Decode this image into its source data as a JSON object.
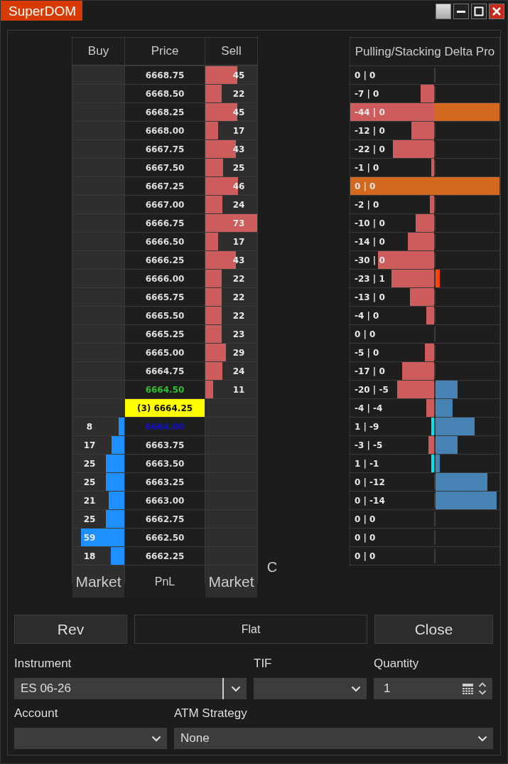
{
  "window": {
    "title": "SuperDOM"
  },
  "ladder": {
    "columns": [
      "Buy",
      "Price",
      "Sell"
    ],
    "rows": [
      {
        "price": "6668.75",
        "kind": "ask",
        "sell": {
          "volume": "45",
          "level": 0.62
        }
      },
      {
        "price": "6668.50",
        "kind": "ask",
        "sell": {
          "volume": "22",
          "level": 0.31
        }
      },
      {
        "price": "6668.25",
        "kind": "ask",
        "sell": {
          "volume": "45",
          "level": 0.62
        }
      },
      {
        "price": "6668.00",
        "kind": "ask",
        "sell": {
          "volume": "17",
          "level": 0.24
        }
      },
      {
        "price": "6667.75",
        "kind": "ask",
        "sell": {
          "volume": "43",
          "level": 0.59
        }
      },
      {
        "price": "6667.50",
        "kind": "ask",
        "sell": {
          "volume": "25",
          "level": 0.34
        }
      },
      {
        "price": "6667.25",
        "kind": "ask",
        "sell": {
          "volume": "46",
          "level": 0.63
        }
      },
      {
        "price": "6667.00",
        "kind": "ask",
        "sell": {
          "volume": "24",
          "level": 0.33
        }
      },
      {
        "price": "6666.75",
        "kind": "ask",
        "sell": {
          "volume": "73",
          "level": 1
        }
      },
      {
        "price": "6666.50",
        "kind": "ask",
        "sell": {
          "volume": "17",
          "level": 0.24
        }
      },
      {
        "price": "6666.25",
        "kind": "ask",
        "sell": {
          "volume": "43",
          "level": 0.59
        }
      },
      {
        "price": "6666.00",
        "kind": "ask",
        "sell": {
          "volume": "22",
          "level": 0.31
        }
      },
      {
        "price": "6665.75",
        "kind": "ask",
        "sell": {
          "volume": "22",
          "level": 0.31
        }
      },
      {
        "price": "6665.50",
        "kind": "ask",
        "sell": {
          "volume": "22",
          "level": 0.31
        }
      },
      {
        "price": "6665.25",
        "kind": "ask",
        "sell": {
          "volume": "23",
          "level": 0.32
        }
      },
      {
        "price": "6665.00",
        "kind": "ask",
        "sell": {
          "volume": "29",
          "level": 0.4
        }
      },
      {
        "price": "6664.75",
        "kind": "ask",
        "sell": {
          "volume": "24",
          "level": 0.33
        }
      },
      {
        "price": "6664.50",
        "kind": "last",
        "sell": {
          "volume": "11",
          "level": 0.15
        }
      },
      {
        "price": "(3) 6664.25",
        "kind": "position"
      },
      {
        "price": "6664.00",
        "kind": "bestbid",
        "buy": {
          "volume": "8",
          "level": 0.11
        }
      },
      {
        "price": "6663.75",
        "kind": "bid",
        "buy": {
          "volume": "17",
          "level": 0.25
        }
      },
      {
        "price": "6663.50",
        "kind": "bid",
        "buy": {
          "volume": "25",
          "level": 0.36
        }
      },
      {
        "price": "6663.25",
        "kind": "bid",
        "buy": {
          "volume": "25",
          "level": 0.36
        }
      },
      {
        "price": "6663.00",
        "kind": "bid",
        "buy": {
          "volume": "21",
          "level": 0.3
        }
      },
      {
        "price": "6662.75",
        "kind": "bid",
        "buy": {
          "volume": "25",
          "level": 0.36
        }
      },
      {
        "price": "6662.50",
        "kind": "bid",
        "buy": {
          "volume": "59",
          "level": 0.84
        }
      },
      {
        "price": "6662.25",
        "kind": "bid",
        "buy": {
          "volume": "18",
          "level": 0.26
        }
      }
    ],
    "footer": {
      "buy_market": "Market",
      "pnl": "PnL",
      "sell_market": "Market",
      "extra": "C"
    }
  },
  "indicator": {
    "title": "Pulling/Stacking Delta Pro",
    "rows": [
      {
        "label": "0 | 0",
        "highlighted": false
      },
      {
        "label": "-7 | 0",
        "highlighted": false,
        "pull": {
          "kind": "negative",
          "level": 0.16
        }
      },
      {
        "label": "-44 | 0",
        "highlighted": true,
        "pull": {
          "kind": "negative",
          "level": 1
        }
      },
      {
        "label": "-12 | 0",
        "highlighted": false,
        "pull": {
          "kind": "negative",
          "level": 0.27
        }
      },
      {
        "label": "-22 | 0",
        "highlighted": false,
        "pull": {
          "kind": "negative",
          "level": 0.49
        }
      },
      {
        "label": "-1 | 0",
        "highlighted": false,
        "pull": {
          "kind": "negative",
          "level": 0.03
        }
      },
      {
        "label": "0 | 0",
        "highlighted": true
      },
      {
        "label": "-2 | 0",
        "highlighted": false,
        "pull": {
          "kind": "negative",
          "level": 0.05
        }
      },
      {
        "label": "-10 | 0",
        "highlighted": false,
        "pull": {
          "kind": "negative",
          "level": 0.22
        }
      },
      {
        "label": "-14 | 0",
        "highlighted": false,
        "pull": {
          "kind": "negative",
          "level": 0.31
        }
      },
      {
        "label": "-30 | 0",
        "highlighted": false,
        "pull": {
          "kind": "negative",
          "level": 0.67
        }
      },
      {
        "label": "-23 | 1",
        "highlighted": false,
        "pull": {
          "kind": "negative",
          "level": 0.51
        },
        "stack": {
          "kind": "positive",
          "level": 0.07
        }
      },
      {
        "label": "-13 | 0",
        "highlighted": false,
        "pull": {
          "kind": "negative",
          "level": 0.29
        }
      },
      {
        "label": "-4 | 0",
        "highlighted": false,
        "pull": {
          "kind": "negative",
          "level": 0.09
        }
      },
      {
        "label": "0 | 0",
        "highlighted": false
      },
      {
        "label": "-5 | 0",
        "highlighted": false,
        "pull": {
          "kind": "negative",
          "level": 0.11
        }
      },
      {
        "label": "-17 | 0",
        "highlighted": false,
        "pull": {
          "kind": "negative",
          "level": 0.38
        }
      },
      {
        "label": "-20 | -5",
        "highlighted": false,
        "pull": {
          "kind": "negative",
          "level": 0.44
        },
        "stack": {
          "kind": "negative",
          "level": 0.34
        }
      },
      {
        "label": "-4 | -4",
        "highlighted": false,
        "pull": {
          "kind": "negative",
          "level": 0.09
        },
        "stack": {
          "kind": "negative",
          "level": 0.27
        }
      },
      {
        "label": "1 | -9",
        "highlighted": false,
        "pull": {
          "kind": "positive",
          "level": 0.03
        },
        "stack": {
          "kind": "negative",
          "level": 0.61
        }
      },
      {
        "label": "-3 | -5",
        "highlighted": false,
        "pull": {
          "kind": "negative",
          "level": 0.07
        },
        "stack": {
          "kind": "negative",
          "level": 0.34
        }
      },
      {
        "label": "1 | -1",
        "highlighted": false,
        "pull": {
          "kind": "positive",
          "level": 0.03
        },
        "stack": {
          "kind": "negative",
          "level": 0.07
        }
      },
      {
        "label": "0 | -12",
        "highlighted": false,
        "stack": {
          "kind": "negative",
          "level": 0.81
        }
      },
      {
        "label": "0 | -14",
        "highlighted": false,
        "stack": {
          "kind": "negative",
          "level": 0.95
        }
      },
      {
        "label": "0 | 0",
        "highlighted": false
      },
      {
        "label": "0 | 0",
        "highlighted": false
      },
      {
        "label": "0 | 0",
        "highlighted": false
      }
    ]
  },
  "buttons": [
    {
      "label": "Rev",
      "kind": "action"
    },
    {
      "label": "Flat",
      "kind": "status"
    },
    {
      "label": "Close",
      "kind": "action"
    }
  ],
  "instrument": {
    "label": "Instrument",
    "value": "ES 06-26"
  },
  "tif": {
    "label": "TIF"
  },
  "quantity": {
    "label": "Quantity",
    "value": "1"
  },
  "account": {
    "label": "Account"
  },
  "atm_strategy": {
    "label": "ATM Strategy",
    "value": "None"
  }
}
